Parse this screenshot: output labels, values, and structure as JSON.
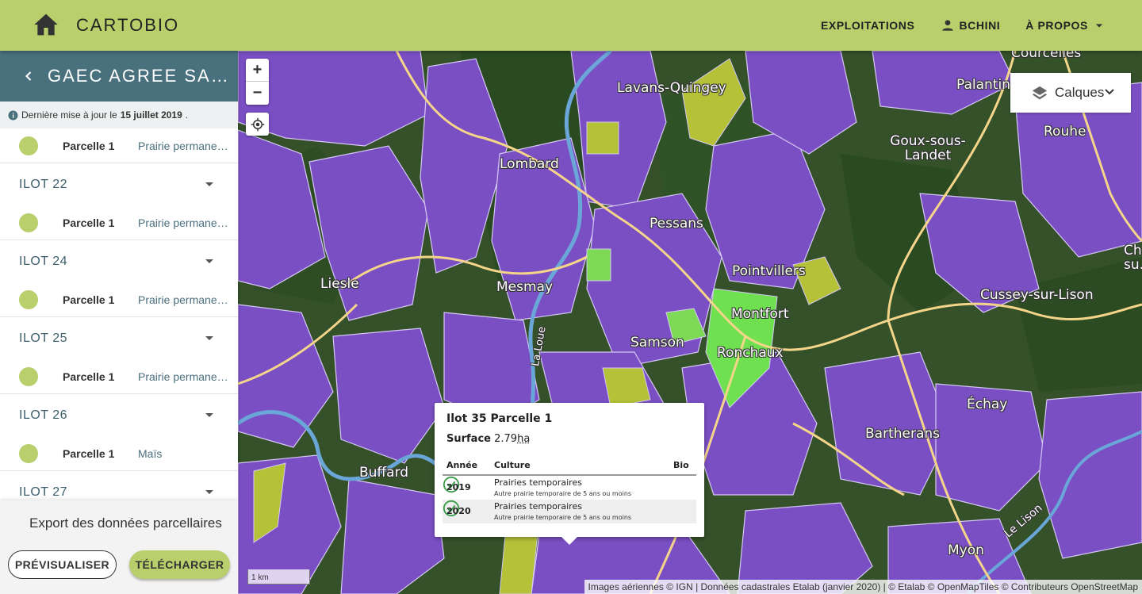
{
  "app": {
    "brand": "CARTOBIO",
    "nav": {
      "exploitations": "EXPLOITATIONS",
      "user": "BCHINI",
      "about": "À PROPOS"
    },
    "icons": [
      "home-icon",
      "person-icon",
      "arrow-drop-down-icon"
    ]
  },
  "sidebar": {
    "title": "GAEC AGREE SAGE C...",
    "update_prefix": "Dernière mise à jour le",
    "update_date": "15 juillet 2019",
    "update_suffix": ".",
    "first_parcel": {
      "name": "Parcelle 1",
      "crop": "Prairie permanente..."
    },
    "ilots": [
      {
        "label": "ILOT 22",
        "parcel": "Parcelle 1",
        "crop": "Prairie permanente..."
      },
      {
        "label": "ILOT 24",
        "parcel": "Parcelle 1",
        "crop": "Prairie permanente..."
      },
      {
        "label": "ILOT 25",
        "parcel": "Parcelle 1",
        "crop": "Prairie permanente..."
      },
      {
        "label": "ILOT 26",
        "parcel": "Parcelle 1",
        "crop": "Maïs"
      },
      {
        "label": "ILOT 27"
      }
    ],
    "export_label": "Export des données parcellaires",
    "preview_button": "PRÉVISUALISER",
    "download_button": "TÉLÉCHARGER",
    "colors": {
      "header": "#49707d",
      "accent": "#b9cf6b"
    }
  },
  "map": {
    "zoom_in": "+",
    "zoom_out": "−",
    "layers_label": "Calques",
    "scale": "1 km",
    "attribution": "Images aériennes © IGN | Données cadastrales Etalab (janvier 2020) | © Etalab © OpenMapTiles © Contributeurs OpenStreetMap",
    "places": [
      "Courcelles",
      "Lavans-Quingey",
      "Palantine",
      "Rouhe",
      "Goux-sous-Landet",
      "Lombard",
      "Pessans",
      "Châ... su...",
      "Liesle",
      "Mesmay",
      "Pointvillers",
      "Cussey-sur-Lison",
      "Montfort",
      "Samson",
      "Ronchaux",
      "Échay",
      "Bartherans",
      "Buffard",
      "Myon",
      "La Loue",
      "Le Lison"
    ],
    "popup": {
      "title": "Ilot 35 Parcelle 1",
      "surface_label": "Surface",
      "surface_value": "2.79",
      "surface_unit": "ha",
      "headers": {
        "year": "Année",
        "crop": "Culture",
        "bio": "Bio"
      },
      "rows": [
        {
          "year": "2019",
          "crop": "Prairies temporaires",
          "sub": "Autre prairie temporaire de 5 ans ou moins",
          "bio": true
        },
        {
          "year": "2020",
          "crop": "Prairies temporaires",
          "sub": "Autre prairie temporaire de 5 ans ou moins",
          "bio": true
        }
      ]
    }
  }
}
